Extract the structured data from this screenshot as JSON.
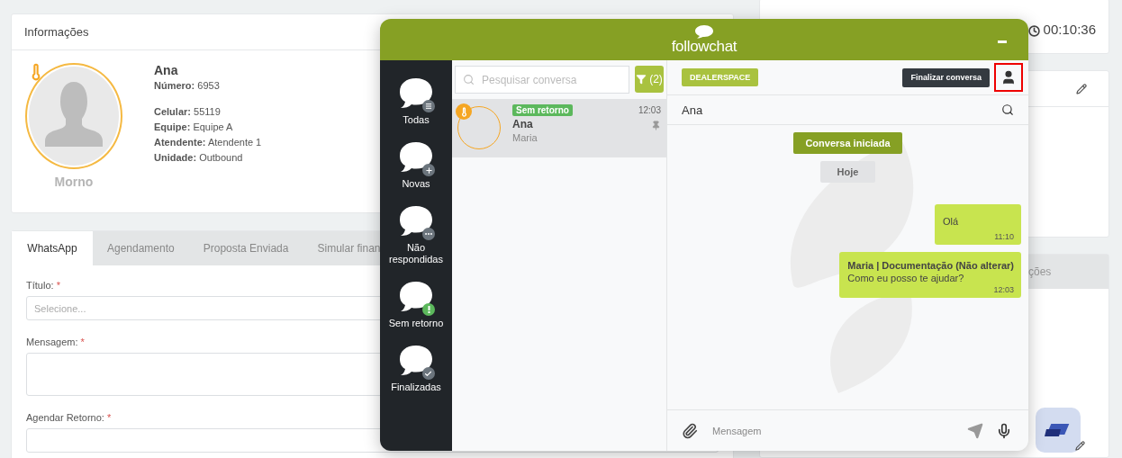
{
  "info_card": {
    "title": "Informações",
    "temperature": "Morno",
    "name": "Ana",
    "number": {
      "label": "Número:",
      "value": "6953"
    },
    "details": [
      {
        "label": "Celular:",
        "value": "55119"
      },
      {
        "label": "Equipe:",
        "value": "Equipe A"
      },
      {
        "label": "Atendente:",
        "value": "Atendente 1"
      },
      {
        "label": "Unidade:",
        "value": "Outbound"
      }
    ]
  },
  "tabs": [
    {
      "label": "WhatsApp",
      "selected": true
    },
    {
      "label": "Agendamento",
      "selected": false
    },
    {
      "label": "Proposta Enviada",
      "selected": false
    },
    {
      "label": "Simular finan",
      "selected": false
    }
  ],
  "form": [
    {
      "kind": "select",
      "label": "Título:",
      "required_mark": "*",
      "placeholder": "Selecione..."
    },
    {
      "kind": "textarea",
      "label": "Mensagem:",
      "required_mark": "*"
    },
    {
      "kind": "input",
      "label": "Agendar Retorno:",
      "required_mark": "*"
    }
  ],
  "timer": "00:10:36",
  "side_tab": "ções",
  "chat": {
    "brand": "followchat",
    "nav": [
      {
        "kind": "all",
        "label": "Todas"
      },
      {
        "kind": "new",
        "label": "Novas"
      },
      {
        "kind": "unanswered",
        "label": "Não respondidas"
      },
      {
        "kind": "no_return",
        "label": "Sem retorno"
      },
      {
        "kind": "finished",
        "label": "Finalizadas"
      }
    ],
    "search": {
      "placeholder": "Pesquisar conversa"
    },
    "filter_count": "(2)",
    "conversations": [
      {
        "status": "Sem retorno",
        "name": "Ana",
        "agent": "Maria",
        "time": "12:03",
        "pinned": true,
        "selected": true
      }
    ],
    "tag": "DEALERSPACE",
    "finish_button": "Finalizar conversa",
    "profile_highlighted": true,
    "contact": "Ana",
    "messages": [
      {
        "kind": "system",
        "text": "Conversa iniciada"
      },
      {
        "kind": "date",
        "text": "Hoje"
      },
      {
        "kind": "outgoing",
        "text": "Olá",
        "time": "11:10"
      },
      {
        "kind": "outgoing",
        "sender": "Maria | Documentação (Não alterar)",
        "text": "Como eu posso te ajudar?",
        "time": "12:03"
      }
    ],
    "composer": {
      "placeholder": "Mensagem"
    }
  }
}
